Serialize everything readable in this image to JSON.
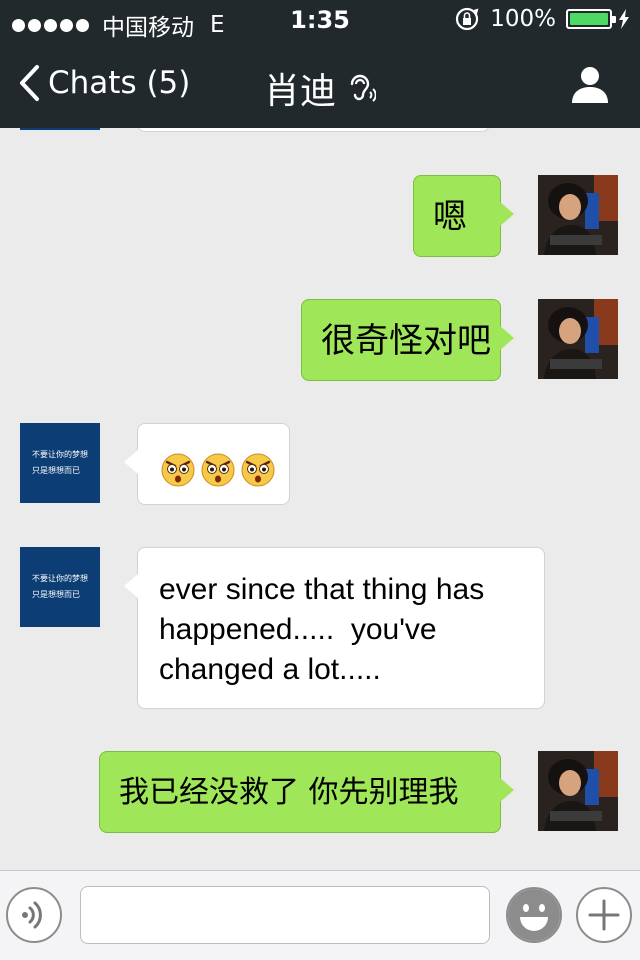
{
  "status_bar": {
    "carrier": "中国移动",
    "network": "E",
    "time": "1:35",
    "battery": "100%",
    "icons": [
      "signal-dots-icon",
      "rotation-lock-icon",
      "battery-icon",
      "charging-icon"
    ]
  },
  "nav": {
    "back_label": "Chats (5)",
    "title": "肖迪",
    "icons": [
      "chevron-left-icon",
      "ear-icon",
      "profile-icon"
    ]
  },
  "messages": [
    {
      "side": "out",
      "text": "嗯"
    },
    {
      "side": "out",
      "text": "很奇怪对吧"
    },
    {
      "side": "in",
      "emoji": [
        "angry-face-icon",
        "angry-face-icon",
        "angry-face-icon"
      ]
    },
    {
      "side": "in",
      "lines": [
        "ever since that thing has",
        "happened.....  you've",
        "changed a lot....."
      ]
    },
    {
      "side": "out",
      "text": "我已经没救了 你先别理我"
    }
  ],
  "friend_avatar": {
    "line1": "不要让你的梦想",
    "line2": "只是想想而已"
  },
  "input_bar": {
    "message_value": "",
    "icons": [
      "voice-icon",
      "emoji-icon",
      "plus-icon"
    ]
  },
  "colors": {
    "header_bg": "#22292c",
    "outgoing_bubble": "#9fe658",
    "incoming_bubble": "#ffffff",
    "chat_bg": "#ebebeb",
    "battery_green": "#4cd964",
    "friend_avatar_bg": "#0c3d74"
  }
}
